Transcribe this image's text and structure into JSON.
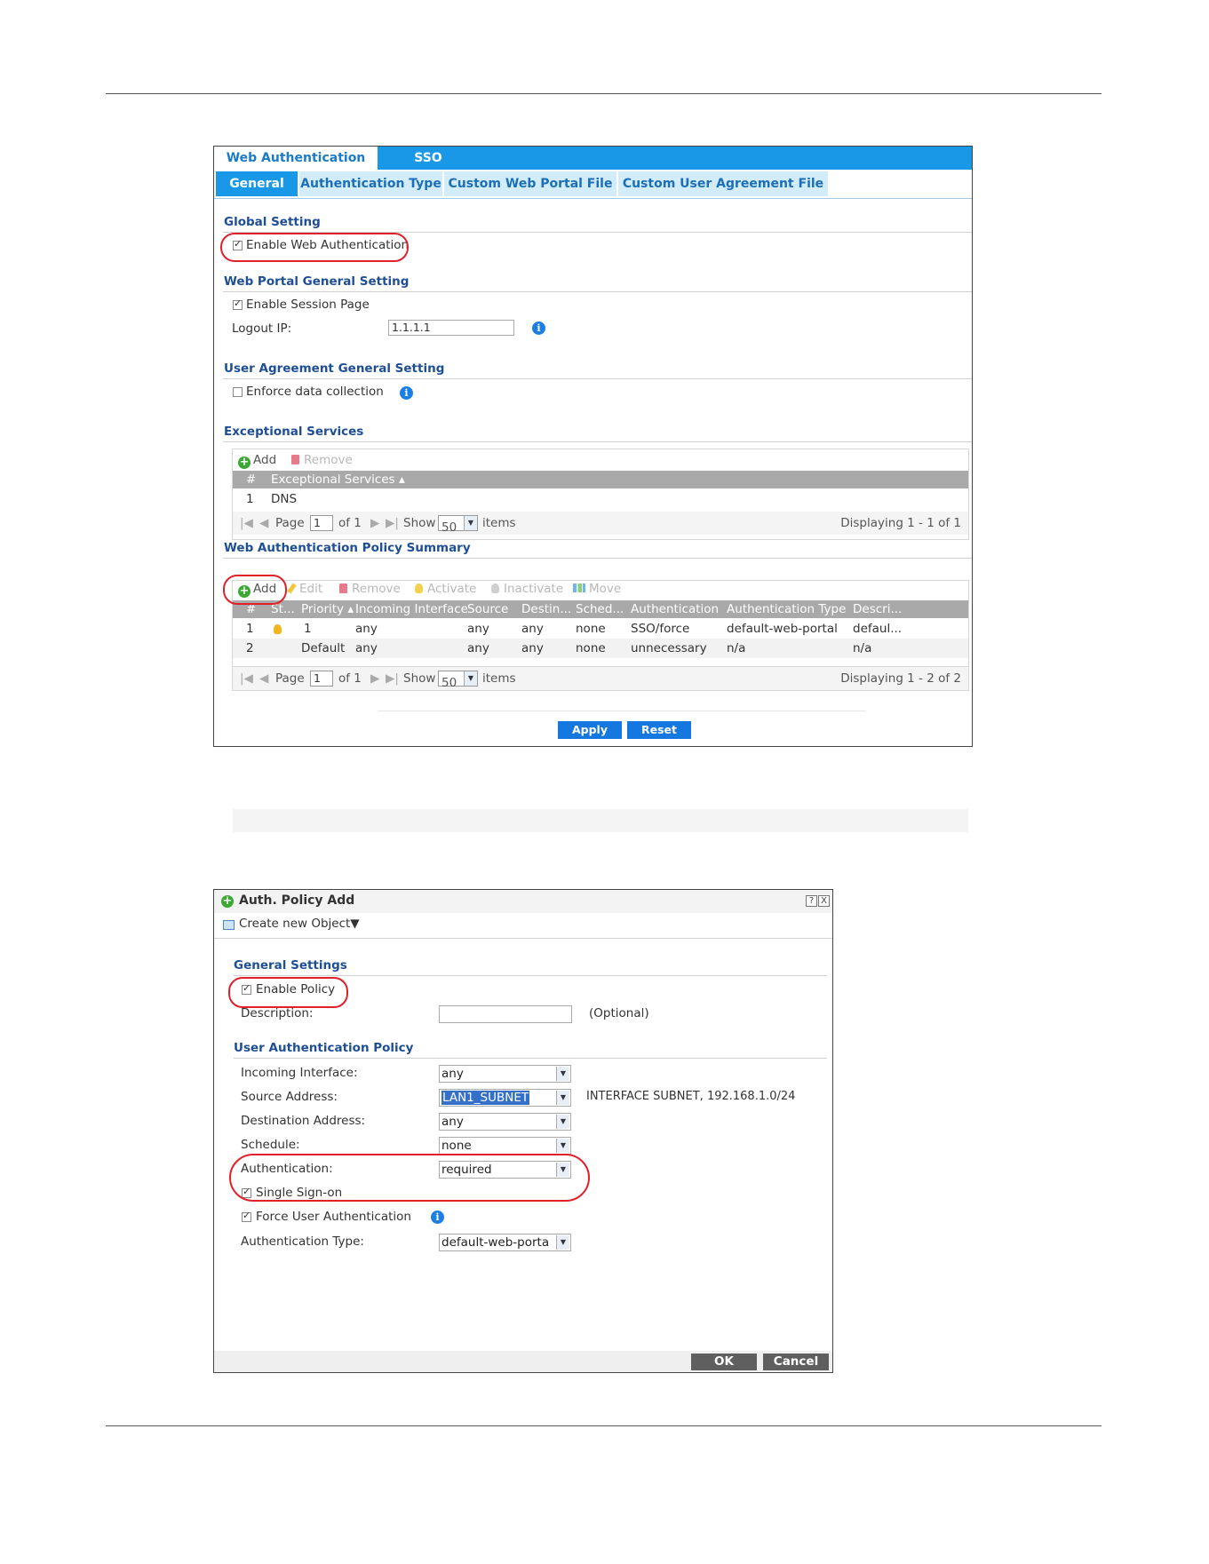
{
  "screen1": {
    "tabs": [
      "Web Authentication",
      "SSO"
    ],
    "subtabs": [
      "General",
      "Authentication Type",
      "Custom Web Portal File",
      "Custom User Agreement File"
    ],
    "global_setting": {
      "title": "Global Setting",
      "enable_web_auth": "Enable Web Authentication"
    },
    "web_portal": {
      "title": "Web Portal General Setting",
      "enable_session_page": "Enable Session Page",
      "logout_ip_label": "Logout IP:",
      "logout_ip_value": "1.1.1.1"
    },
    "user_agreement": {
      "title": "User Agreement General Setting",
      "enforce_data_collection": "Enforce data collection"
    },
    "exceptional_services": {
      "title": "Exceptional Services",
      "toolbar": {
        "add": "Add",
        "remove": "Remove"
      },
      "columns": [
        "#",
        "Exceptional Services ▴"
      ],
      "rows": [
        {
          "num": "1",
          "service": "DNS"
        }
      ],
      "pager": {
        "page": "Page",
        "page_value": "1",
        "of": "of 1",
        "show": "Show",
        "show_value": "50",
        "items": "items",
        "displaying": "Displaying 1 - 1 of 1"
      }
    },
    "policy_summary": {
      "title": "Web Authentication Policy Summary",
      "toolbar": {
        "add": "Add",
        "edit": "Edit",
        "remove": "Remove",
        "activate": "Activate",
        "inactivate": "Inactivate",
        "move": "Move"
      },
      "columns": [
        "#",
        "St...",
        "Priority ▴",
        "Incoming Interface",
        "Source",
        "Destin...",
        "Sched...",
        "Authentication",
        "Authentication Type",
        "Descri..."
      ],
      "rows": [
        {
          "num": "1",
          "priority": "1",
          "incoming": "any",
          "source": "any",
          "dest": "any",
          "schedule": "none",
          "auth": "SSO/force",
          "auth_type": "default-web-portal",
          "desc": "defaul..."
        },
        {
          "num": "2",
          "priority": "Default",
          "incoming": "any",
          "source": "any",
          "dest": "any",
          "schedule": "none",
          "auth": "unnecessary",
          "auth_type": "n/a",
          "desc": "n/a"
        }
      ],
      "pager": {
        "page": "Page",
        "page_value": "1",
        "of": "of 1",
        "show": "Show",
        "show_value": "50",
        "items": "items",
        "displaying": "Displaying 1 - 2 of 2"
      }
    },
    "buttons": {
      "apply": "Apply",
      "reset": "Reset"
    }
  },
  "screen2": {
    "title": "Auth. Policy Add",
    "help": "?",
    "close": "X",
    "create_new_object": "Create new Object▼",
    "general": {
      "title": "General Settings",
      "enable_policy": "Enable Policy",
      "description_label": "Description:",
      "description_value": "",
      "optional": "(Optional)"
    },
    "user_auth": {
      "title": "User Authentication Policy",
      "incoming_label": "Incoming Interface:",
      "incoming_value": "any",
      "source_label": "Source Address:",
      "source_value": "LAN1_SUBNET",
      "source_info": "INTERFACE SUBNET, 192.168.1.0/24",
      "dest_label": "Destination Address:",
      "dest_value": "any",
      "schedule_label": "Schedule:",
      "schedule_value": "none",
      "auth_label": "Authentication:",
      "auth_value": "required",
      "sso": "Single Sign-on",
      "force": "Force User Authentication",
      "auth_type_label": "Authentication Type:",
      "auth_type_value": "default-web-porta"
    },
    "buttons": {
      "ok": "OK",
      "cancel": "Cancel"
    }
  }
}
